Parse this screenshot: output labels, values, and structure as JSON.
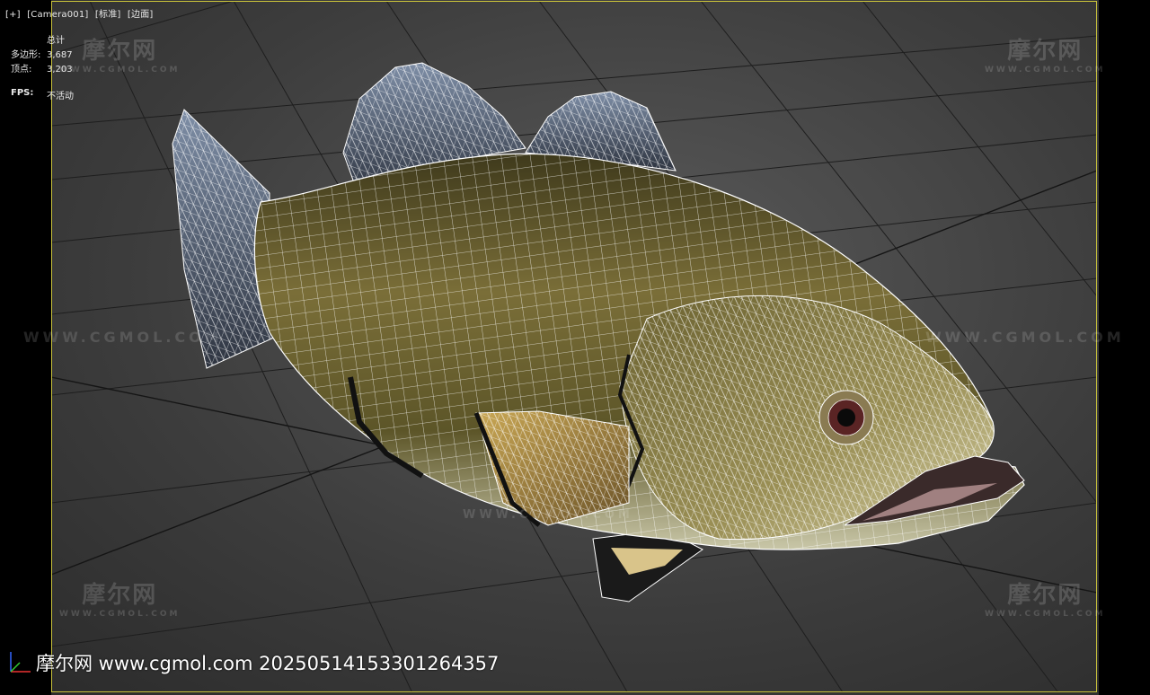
{
  "viewport": {
    "labels": [
      "[+]",
      "[Camera001]",
      "[标准]",
      "[边面]"
    ]
  },
  "stats": {
    "header": "总计",
    "polys_label": "多边形:",
    "polys_value": "3,687",
    "verts_label": "顶点:",
    "verts_value": "3,203",
    "fps_label": "FPS:",
    "fps_value": "不活动"
  },
  "watermark": {
    "brand": "摩尔网",
    "url_small": "WWW.CGMOL.COM",
    "url_line": "WWW.CGMOL.COM"
  },
  "footer": {
    "text": "摩尔网 www.cgmol.com 20250514153301264357"
  },
  "colors": {
    "safe_frame": "#c9c23a",
    "grid": "#1c1c1c",
    "wire": "#ffffff",
    "axis_x": "#e33",
    "axis_y": "#3c3",
    "axis_z": "#36f"
  }
}
